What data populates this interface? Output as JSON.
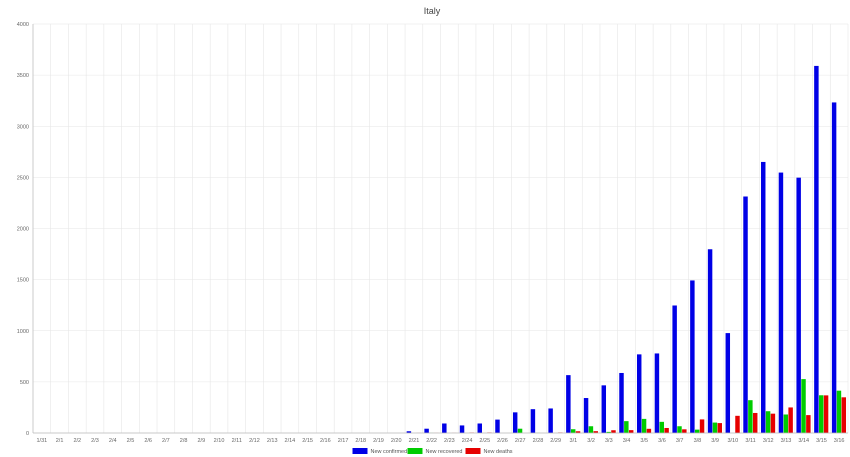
{
  "chart_data": {
    "type": "bar",
    "title": "Italy",
    "xlabel": "",
    "ylabel": "",
    "ylim": [
      0,
      4000
    ],
    "yticks": [
      0,
      500,
      1000,
      1500,
      2000,
      2500,
      3000,
      3500,
      4000
    ],
    "grid": true,
    "legend_position": "bottom",
    "categories": [
      "1/31",
      "2/1",
      "2/2",
      "2/3",
      "2/4",
      "2/5",
      "2/6",
      "2/7",
      "2/8",
      "2/9",
      "2/10",
      "2/11",
      "2/12",
      "2/13",
      "2/14",
      "2/15",
      "2/16",
      "2/17",
      "2/18",
      "2/19",
      "2/20",
      "2/21",
      "2/22",
      "2/23",
      "2/24",
      "2/25",
      "2/26",
      "2/27",
      "2/28",
      "2/29",
      "3/1",
      "3/2",
      "3/3",
      "3/4",
      "3/5",
      "3/6",
      "3/7",
      "3/8",
      "3/9",
      "3/10",
      "3/11",
      "3/12",
      "3/13",
      "3/14",
      "3/15",
      "3/16"
    ],
    "series": [
      {
        "name": "New confirmed",
        "color": "#0000e6",
        "values": [
          0,
          0,
          0,
          0,
          0,
          0,
          0,
          0,
          0,
          0,
          0,
          0,
          0,
          0,
          0,
          0,
          0,
          0,
          0,
          0,
          0,
          17,
          42,
          93,
          74,
          93,
          131,
          202,
          233,
          240,
          566,
          342,
          466,
          587,
          769,
          778,
          1247,
          1492,
          1797,
          977,
          2313,
          2651,
          2547,
          2497,
          3590,
          3233
        ]
      },
      {
        "name": "New recovered",
        "color": "#00cc00",
        "values": [
          0,
          0,
          0,
          0,
          0,
          0,
          0,
          0,
          0,
          0,
          0,
          0,
          0,
          0,
          0,
          0,
          0,
          0,
          0,
          0,
          0,
          0,
          1,
          0,
          0,
          0,
          0,
          42,
          1,
          0,
          37,
          66,
          11,
          116,
          138,
          109,
          66,
          33,
          102,
          0,
          321,
          213,
          181,
          527,
          369,
          414
        ]
      },
      {
        "name": "New deaths",
        "color": "#e60000",
        "values": [
          0,
          0,
          0,
          0,
          0,
          0,
          0,
          0,
          0,
          0,
          0,
          0,
          0,
          0,
          0,
          0,
          0,
          0,
          0,
          0,
          0,
          1,
          1,
          1,
          4,
          5,
          0,
          0,
          0,
          5,
          17,
          18,
          27,
          28,
          41,
          49,
          36,
          133,
          97,
          168,
          196,
          189,
          250,
          175,
          368,
          349
        ]
      }
    ]
  }
}
